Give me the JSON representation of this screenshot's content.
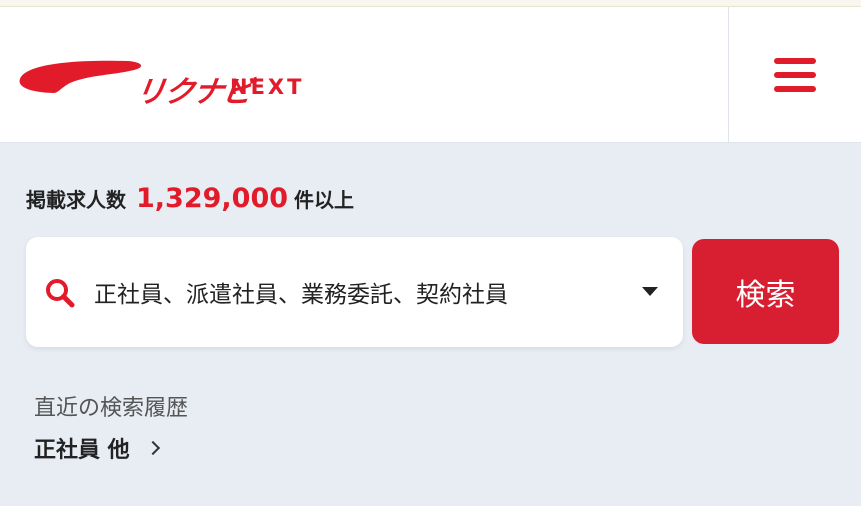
{
  "header": {
    "logo_kana": "リクナビ",
    "logo_next": "NEXT",
    "brand_color": "#e21b2b"
  },
  "listing": {
    "count_label": "掲載求人数",
    "count_value": "1,329,000",
    "count_suffix": "件以上"
  },
  "search": {
    "employment_types": "正社員、派遣社員、業務委託、契約社員",
    "button_label": "検索",
    "icon": "search-icon",
    "dropdown_icon": "caret-down-icon"
  },
  "history": {
    "title": "直近の検索履歴",
    "items": [
      {
        "label": "正社員 他"
      }
    ]
  }
}
